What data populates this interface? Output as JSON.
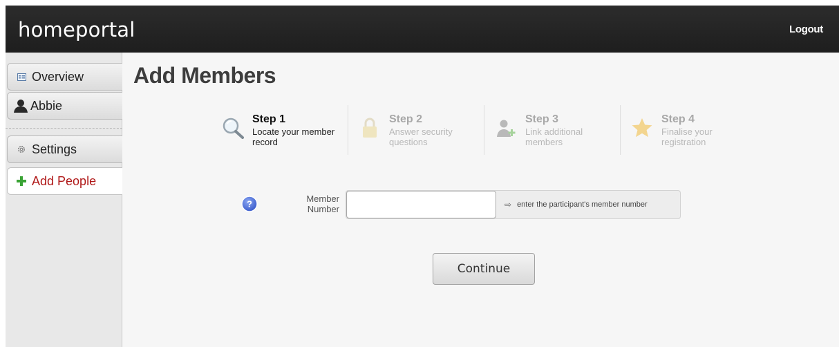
{
  "header": {
    "brand": "homeportal",
    "logout_label": "Logout"
  },
  "sidebar": {
    "items": [
      {
        "label": "Overview",
        "icon": "overview-icon"
      },
      {
        "label": "Abbie",
        "icon": "person-silhouette-icon"
      },
      {
        "label": "Settings",
        "icon": "gear-icon"
      },
      {
        "label": "Add People",
        "icon": "plus-icon",
        "active": true
      }
    ]
  },
  "main": {
    "title": "Add Members",
    "steps": [
      {
        "title": "Step 1",
        "desc": "Locate your member record",
        "icon": "magnifier-icon",
        "state": "current"
      },
      {
        "title": "Step 2",
        "desc": "Answer security questions",
        "icon": "padlock-icon",
        "state": "future"
      },
      {
        "title": "Step 3",
        "desc": "Link additional members",
        "icon": "add-user-icon",
        "state": "future"
      },
      {
        "title": "Step 4",
        "desc": "Finalise your registration",
        "icon": "star-icon",
        "state": "future"
      }
    ],
    "form": {
      "label_line1": "Member",
      "label_line2": "Number",
      "value": "",
      "hint": "enter the participant's member number",
      "help_icon": "question-mark-icon"
    },
    "continue_label": "Continue"
  },
  "colors": {
    "header_bg": "#222222",
    "active_nav_text": "#b01818",
    "plus_green": "#3aa335",
    "help_blue": "#4a6fd6"
  }
}
